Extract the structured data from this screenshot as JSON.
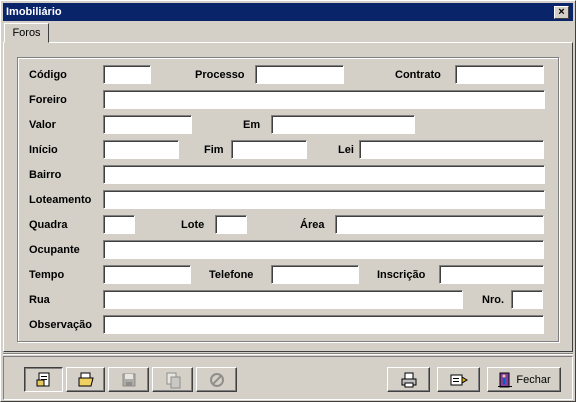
{
  "window": {
    "title": "Imobiliário",
    "close_label": "×"
  },
  "tabs": [
    {
      "label": "Foros"
    }
  ],
  "form": {
    "codigo": {
      "label": "Código",
      "value": ""
    },
    "processo": {
      "label": "Processo",
      "value": ""
    },
    "contrato": {
      "label": "Contrato",
      "value": ""
    },
    "foreiro": {
      "label": "Foreiro",
      "value": ""
    },
    "valor": {
      "label": "Valor",
      "value": ""
    },
    "em": {
      "label": "Em",
      "value": ""
    },
    "inicio": {
      "label": "Início",
      "value": ""
    },
    "fim": {
      "label": "Fim",
      "value": ""
    },
    "lei": {
      "label": "Lei",
      "value": ""
    },
    "bairro": {
      "label": "Bairro",
      "value": ""
    },
    "loteamento": {
      "label": "Loteamento",
      "value": ""
    },
    "quadra": {
      "label": "Quadra",
      "value": ""
    },
    "lote": {
      "label": "Lote",
      "value": ""
    },
    "area": {
      "label": "Área",
      "value": ""
    },
    "ocupante": {
      "label": "Ocupante",
      "value": ""
    },
    "tempo": {
      "label": "Tempo",
      "value": ""
    },
    "telefone": {
      "label": "Telefone",
      "value": ""
    },
    "inscricao": {
      "label": "Inscrição",
      "value": ""
    },
    "rua": {
      "label": "Rua",
      "value": ""
    },
    "nro": {
      "label": "Nro.",
      "value": ""
    },
    "observacao": {
      "label": "Observação",
      "value": ""
    }
  },
  "toolbar": {
    "buttons": [
      {
        "icon": "new-record-icon",
        "enabled": true,
        "pressed": true
      },
      {
        "icon": "open-folder-icon",
        "enabled": true
      },
      {
        "icon": "save-icon",
        "enabled": false
      },
      {
        "icon": "copy-icon",
        "enabled": false
      },
      {
        "icon": "cancel-icon",
        "enabled": false
      },
      {
        "icon": "printer-icon",
        "enabled": true
      },
      {
        "icon": "search-icon",
        "enabled": true
      },
      {
        "icon": "exit-door-icon",
        "enabled": true,
        "label": "Fechar"
      }
    ]
  },
  "colors": {
    "titlebar": "#0a246a",
    "face": "#d4d0c8"
  }
}
